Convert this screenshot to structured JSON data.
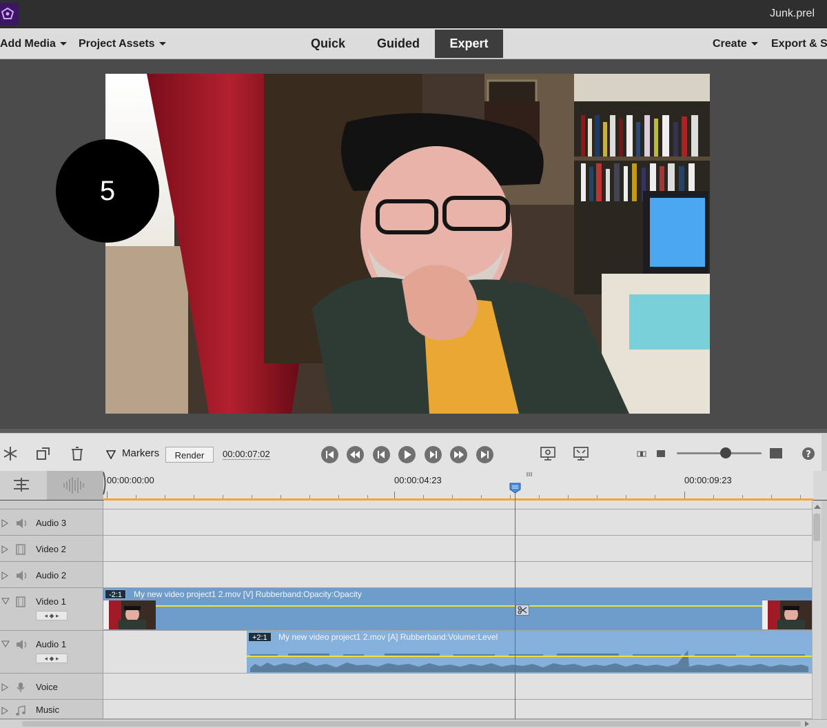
{
  "window": {
    "file_name": "Junk.prel"
  },
  "menu": {
    "add_media": "Add Media",
    "project_assets": "Project Assets",
    "create": "Create",
    "export_share": "Export & S"
  },
  "modes": {
    "quick": "Quick",
    "guided": "Guided",
    "expert": "Expert",
    "active": "Expert"
  },
  "monitor": {
    "step_badge": "5"
  },
  "toolbar": {
    "markers_label": "Markers",
    "render_label": "Render",
    "current_timecode": "00:00:07:02",
    "icons": [
      "freeze-frame-icon",
      "smart-fit-icon",
      "trash-icon",
      "marker-icon",
      "go-to-start-icon",
      "rewind-icon",
      "step-back-icon",
      "play-icon",
      "step-forward-icon",
      "fast-forward-icon",
      "go-to-end-icon",
      "render-preview-icon",
      "fit-to-screen-icon",
      "help-icon"
    ]
  },
  "ruler": {
    "labels": [
      "00:00:00:00",
      "00:00:04:23",
      "00:00:09:23"
    ]
  },
  "tracks": [
    {
      "name": "Audio 3",
      "kind": "audio"
    },
    {
      "name": "Video 2",
      "kind": "video"
    },
    {
      "name": "Audio 2",
      "kind": "audio"
    },
    {
      "name": "Video 1",
      "kind": "video"
    },
    {
      "name": "Audio 1",
      "kind": "audio"
    },
    {
      "name": "Voice",
      "kind": "voice"
    },
    {
      "name": "Music",
      "kind": "music"
    }
  ],
  "clips": {
    "video": {
      "badge": "-2:1",
      "title": "My new video project1 2.mov [V] Rubberband:Opacity:Opacity"
    },
    "audio": {
      "badge": "+2:1",
      "title": "My new video project1 2.mov [A] Rubberband:Volume:Level"
    }
  },
  "colors": {
    "clip_video": "#6f9dcb",
    "clip_audio": "#86b0dc",
    "playhead": "#e03a3a",
    "work_area": "#f2a536",
    "rubberband": "#f2e23a"
  }
}
